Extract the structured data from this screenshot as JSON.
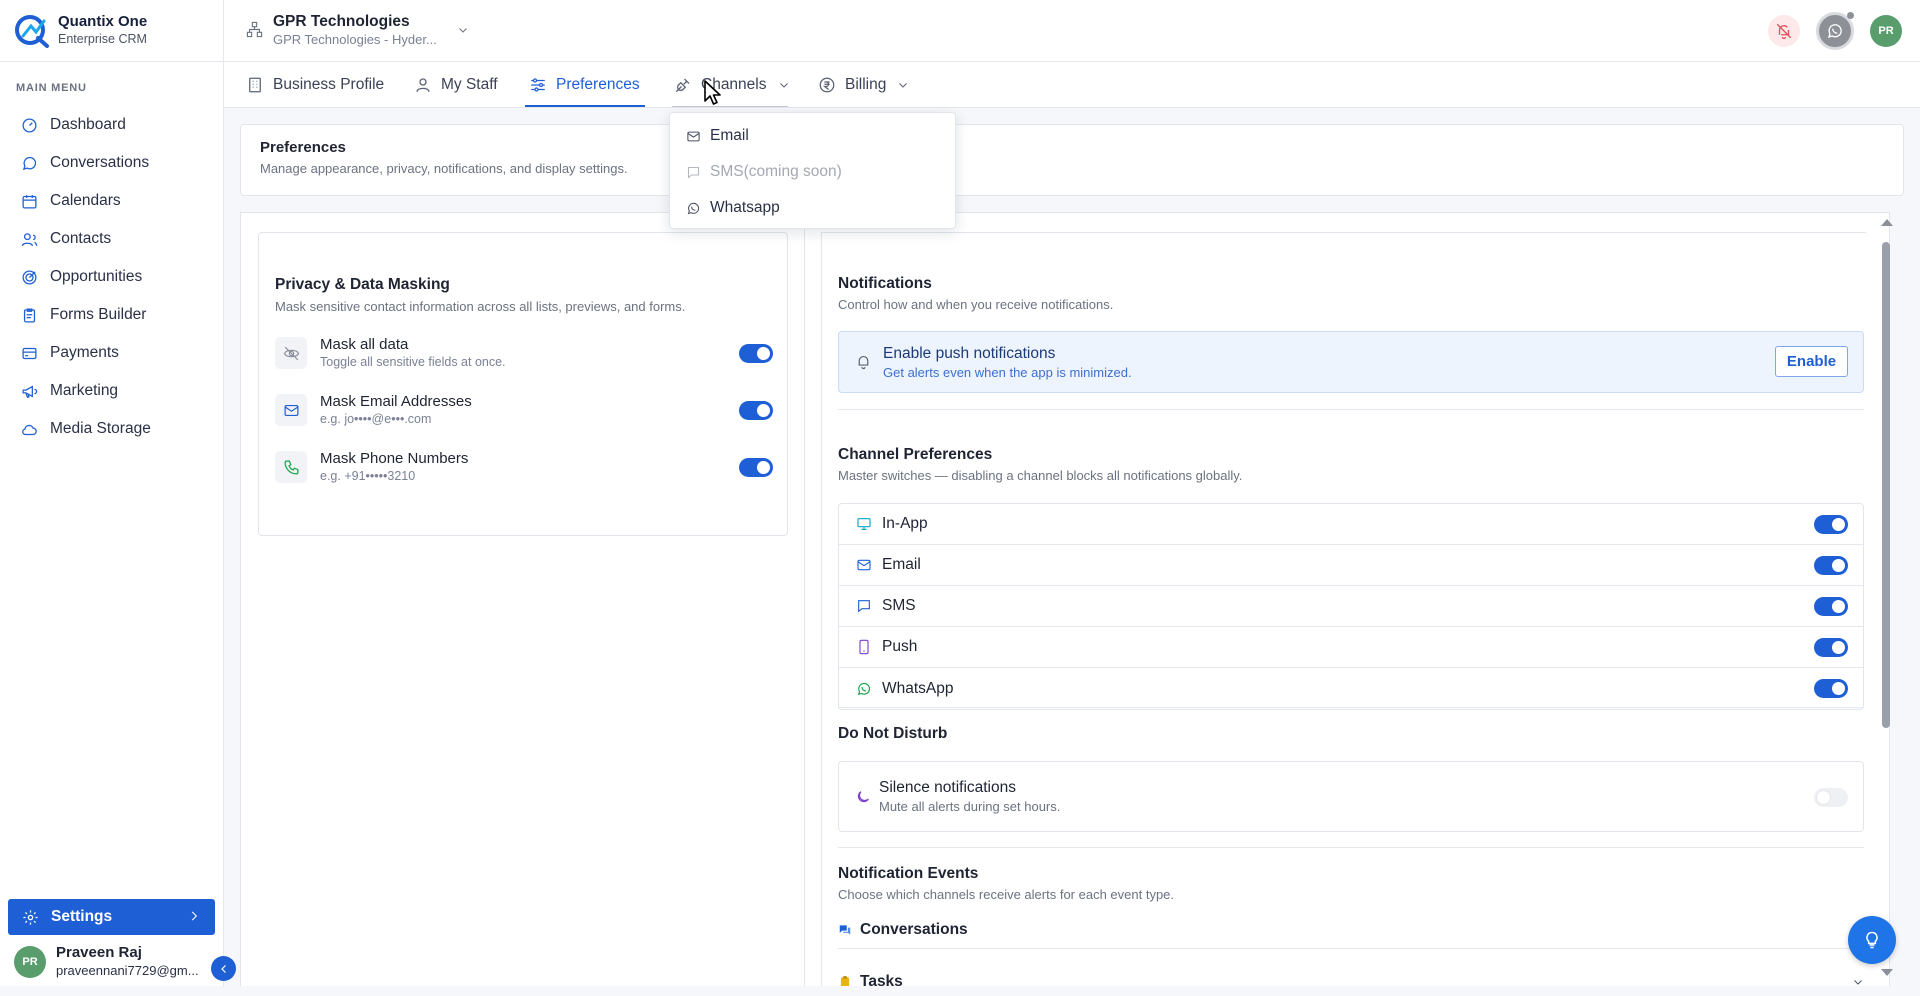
{
  "brand": {
    "name": "Quantix One",
    "subtitle": "Enterprise CRM"
  },
  "sidebar": {
    "menu_title": "MAIN MENU",
    "items": [
      {
        "label": "Dashboard",
        "icon": "dashboard-icon"
      },
      {
        "label": "Conversations",
        "icon": "chat-icon"
      },
      {
        "label": "Calendars",
        "icon": "calendar-icon"
      },
      {
        "label": "Contacts",
        "icon": "contacts-icon"
      },
      {
        "label": "Opportunities",
        "icon": "target-icon"
      },
      {
        "label": "Forms Builder",
        "icon": "clipboard-icon"
      },
      {
        "label": "Payments",
        "icon": "card-icon"
      },
      {
        "label": "Marketing",
        "icon": "megaphone-icon"
      },
      {
        "label": "Media Storage",
        "icon": "cloud-icon"
      }
    ],
    "settings_label": "Settings",
    "user": {
      "initials": "PR",
      "name": "Praveen Raj",
      "email": "praveennani7729@gm..."
    }
  },
  "header": {
    "org_name": "GPR Technologies",
    "org_sub": "GPR Technologies - Hyder...",
    "avatar_initials": "PR"
  },
  "tabs": [
    {
      "label": "Business Profile",
      "icon": "building-icon"
    },
    {
      "label": "My Staff",
      "icon": "user-icon"
    },
    {
      "label": "Preferences",
      "icon": "sliders-icon",
      "active": true
    },
    {
      "label": "Channels",
      "icon": "plug-icon",
      "dropdown": true
    },
    {
      "label": "Billing",
      "icon": "rupee-icon",
      "dropdown": true
    }
  ],
  "channels_menu": [
    {
      "label": "Email",
      "icon": "mail-icon",
      "disabled": false
    },
    {
      "label": "SMS(coming soon)",
      "icon": "message-icon",
      "disabled": true
    },
    {
      "label": "Whatsapp",
      "icon": "whatsapp-icon",
      "disabled": false
    }
  ],
  "preferences": {
    "title": "Preferences",
    "subtitle": "Manage appearance, privacy, notifications, and display settings."
  },
  "privacy": {
    "title": "Privacy & Data Masking",
    "subtitle": "Mask sensitive contact information across all lists, previews, and forms.",
    "rows": [
      {
        "label": "Mask all data",
        "hint": "Toggle all sensitive fields at once.",
        "icon": "eye-off-icon",
        "enabled": true
      },
      {
        "label": "Mask Email Addresses",
        "hint": "e.g. jo••••@e•••.com",
        "icon": "mail-icon",
        "enabled": true
      },
      {
        "label": "Mask Phone Numbers",
        "hint": "e.g. +91•••••3210",
        "icon": "phone-icon",
        "enabled": true
      }
    ]
  },
  "notifications": {
    "title": "Notifications",
    "subtitle": "Control how and when you receive notifications.",
    "push": {
      "title": "Enable push notifications",
      "subtitle": "Get alerts even when the app is minimized.",
      "button": "Enable"
    },
    "channel_prefs": {
      "title": "Channel Preferences",
      "subtitle": "Master switches — disabling a channel blocks all notifications globally.",
      "rows": [
        {
          "label": "In-App",
          "icon": "monitor-icon",
          "enabled": true
        },
        {
          "label": "Email",
          "icon": "mail-icon",
          "enabled": true
        },
        {
          "label": "SMS",
          "icon": "message-icon",
          "enabled": true
        },
        {
          "label": "Push",
          "icon": "mobile-icon",
          "enabled": true
        },
        {
          "label": "WhatsApp",
          "icon": "whatsapp-icon",
          "enabled": true
        }
      ]
    },
    "dnd": {
      "title": "Do Not Disturb",
      "row_title": "Silence notifications",
      "row_sub": "Mute all alerts during set hours.",
      "enabled": false
    },
    "events": {
      "title": "Notification Events",
      "subtitle": "Choose which channels receive alerts for each event type.",
      "items": [
        {
          "label": "Conversations",
          "icon": "chat-bubbles-icon"
        },
        {
          "label": "Tasks",
          "icon": "clipboard-icon"
        }
      ]
    }
  },
  "colors": {
    "accent": "#1f5fd6",
    "toggle_on": "#1f5fd6",
    "toggle_off": "#eef0f3"
  }
}
